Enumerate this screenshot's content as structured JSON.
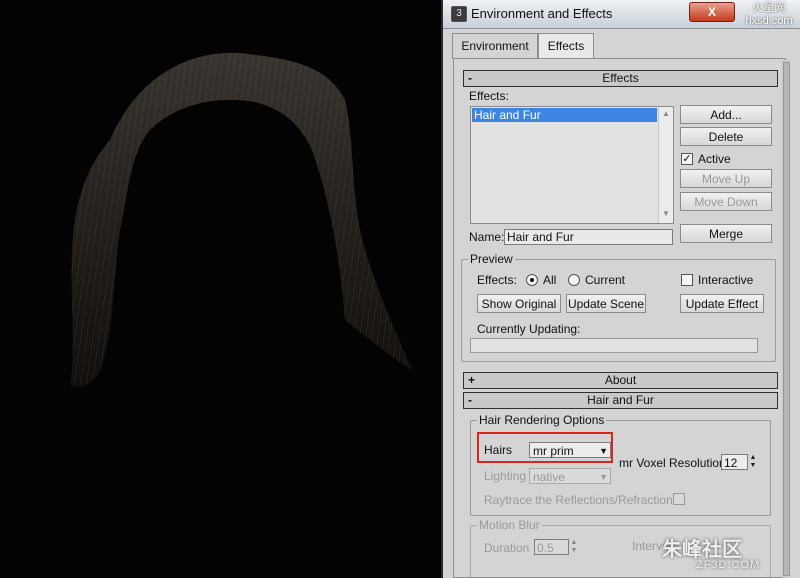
{
  "dialog": {
    "title": "Environment and Effects",
    "app_icon_glyph": "3",
    "close_glyph": "X",
    "corner_watermark": "火星网 hxsd.com"
  },
  "tabs": [
    {
      "label": "Environment",
      "selected": false
    },
    {
      "label": "Effects",
      "selected": true
    }
  ],
  "effects_rollout": {
    "header": "Effects",
    "header_sign": "-",
    "effects_label": "Effects:",
    "list_items": [
      "Hair and Fur"
    ],
    "add_button": "Add...",
    "delete_button": "Delete",
    "active_label": "Active",
    "active_checked": true,
    "move_up_button": "Move Up",
    "move_down_button": "Move Down",
    "name_label": "Name:",
    "name_value": "Hair and Fur",
    "merge_button": "Merge"
  },
  "preview": {
    "group_title": "Preview",
    "effects_label": "Effects:",
    "all_label": "All",
    "current_label": "Current",
    "selected_option": "All",
    "interactive_label": "Interactive",
    "interactive_checked": false,
    "show_original_button": "Show Original",
    "update_scene_button": "Update Scene",
    "update_effect_button": "Update Effect",
    "currently_updating_label": "Currently Updating:"
  },
  "about_rollout": {
    "header": "About",
    "header_sign": "+"
  },
  "hair_fur_rollout": {
    "header": "Hair and Fur",
    "header_sign": "-",
    "rendering_group_title": "Hair Rendering Options",
    "hairs_label": "Hairs",
    "hairs_value": "mr prim",
    "voxel_label": "mr Voxel Resolution",
    "voxel_value": "12",
    "lighting_label": "Lighting",
    "lighting_value": "native",
    "raytrace_label": "Raytrace the Reflections/Refractions",
    "raytrace_checked": false,
    "motion_blur_group_title": "Motion Blur",
    "duration_label": "Duration",
    "duration_value": "0.5",
    "interval_label": "Interval"
  },
  "watermark": {
    "text": "朱峰社区",
    "sub": "ZF3D.COM"
  },
  "colors": {
    "selection": "#3b86e0",
    "highlight_box": "#d9251f",
    "dialog_bg": "#d4d4d4",
    "render_bg": "#030303"
  }
}
